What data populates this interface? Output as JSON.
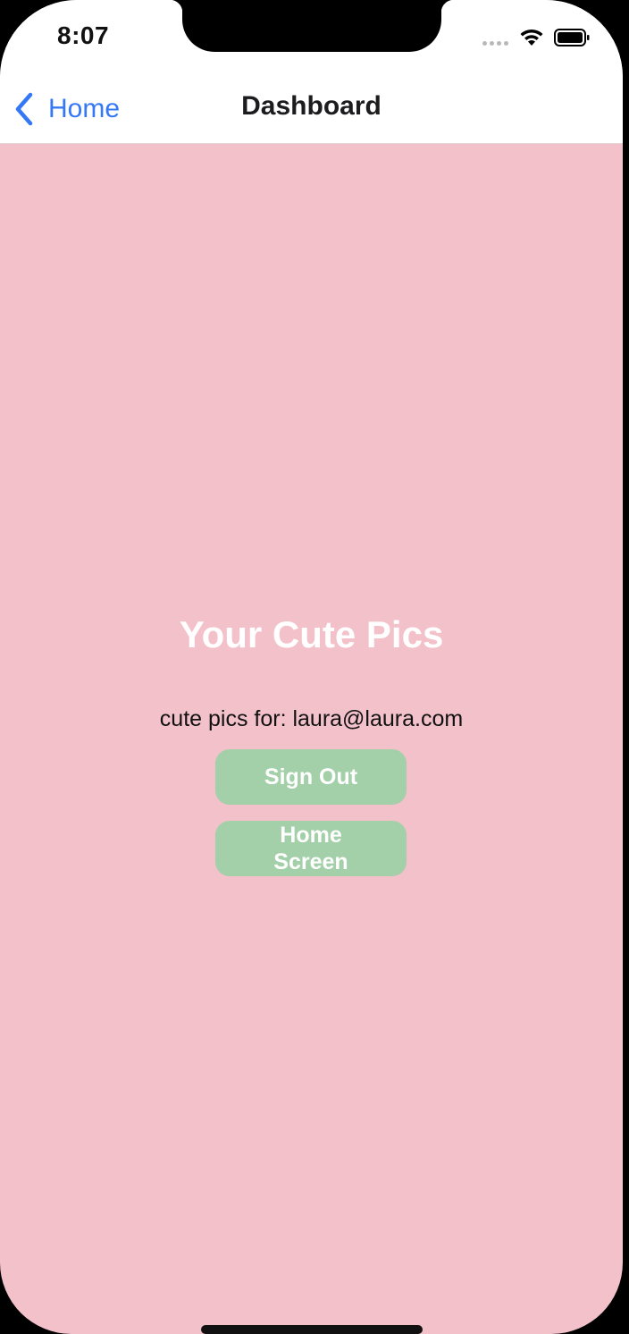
{
  "status_bar": {
    "time": "8:07"
  },
  "nav_bar": {
    "back_label": "Home",
    "title": "Dashboard"
  },
  "content": {
    "title": "Your Cute Pics",
    "subtitle": "cute pics for: laura@laura.com",
    "sign_out_label": "Sign Out",
    "home_screen_label": "Home Screen"
  },
  "colors": {
    "background": "#f3c1ca",
    "button": "#a3cfa9",
    "link": "#3478f6"
  },
  "icons": {
    "back": "chevron-left-icon",
    "signal": "cellular-signal-icon",
    "wifi": "wifi-icon",
    "battery": "battery-icon"
  }
}
